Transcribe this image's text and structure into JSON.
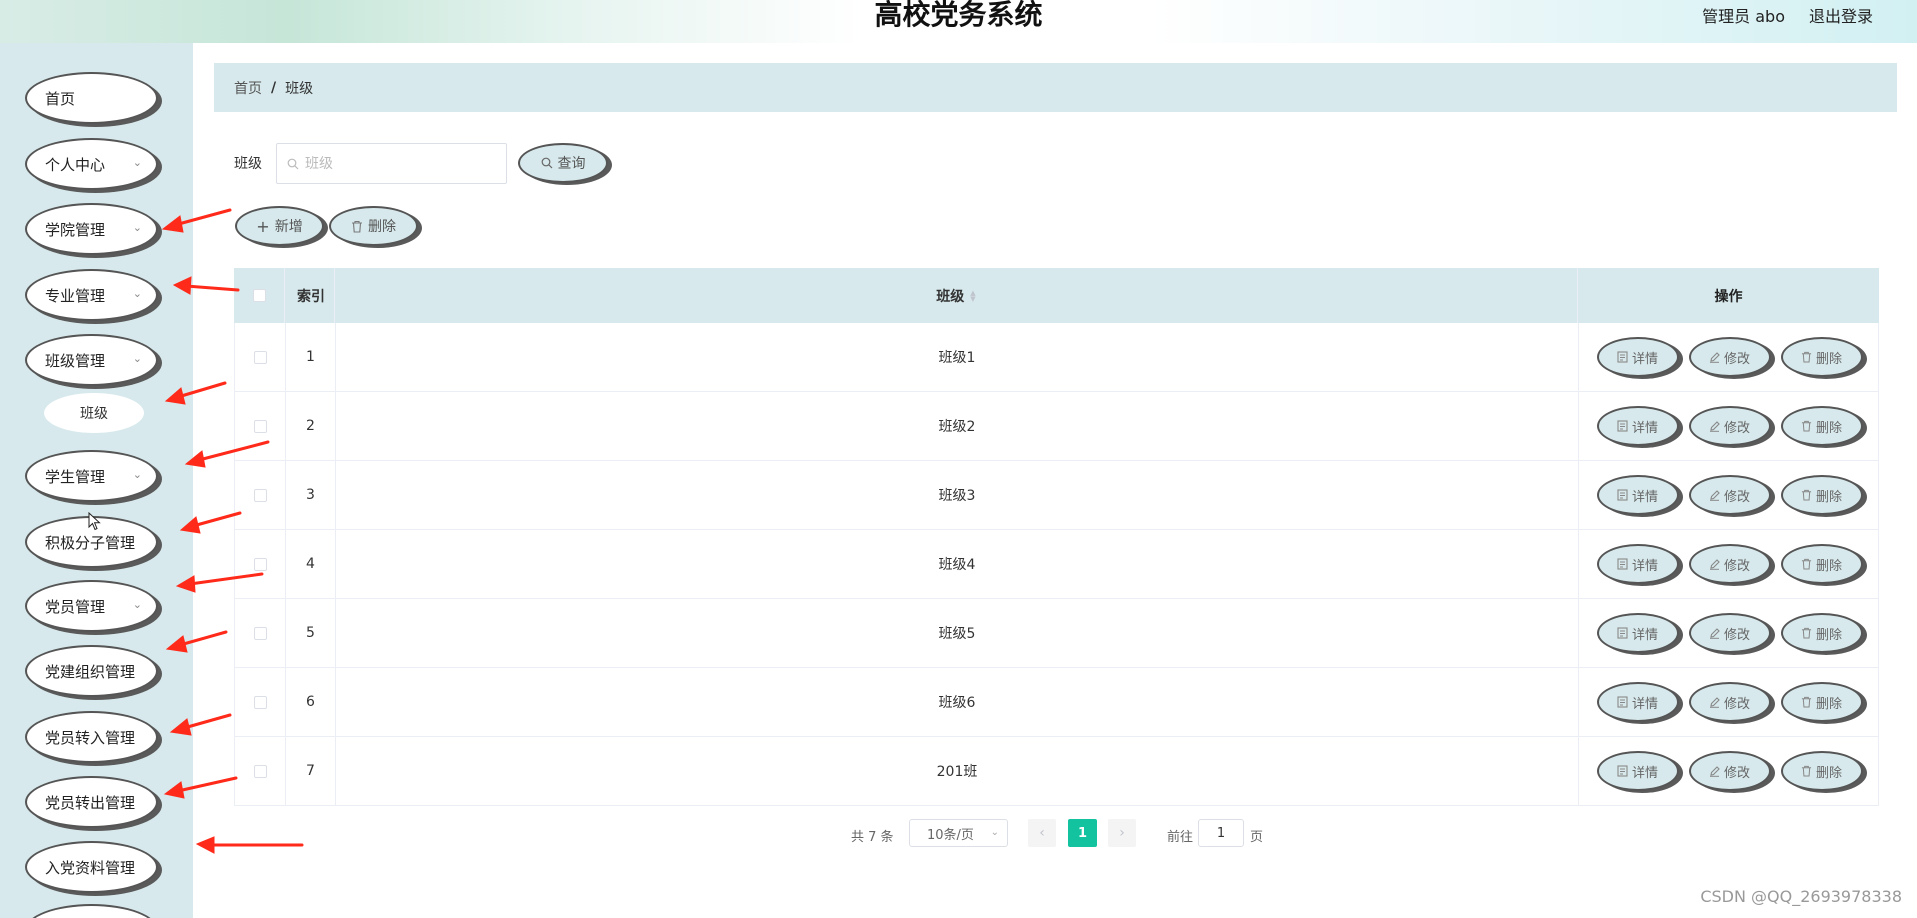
{
  "header": {
    "title": "高校党务系统",
    "admin": "管理员 abo",
    "logout": "退出登录"
  },
  "sidebar": {
    "items": [
      {
        "label": "首页",
        "chevron": false
      },
      {
        "label": "个人中心",
        "chevron": true
      },
      {
        "label": "学院管理",
        "chevron": true
      },
      {
        "label": "专业管理",
        "chevron": true
      },
      {
        "label": "班级管理",
        "chevron": true
      },
      {
        "label": "学生管理",
        "chevron": true
      },
      {
        "label": "积极分子管理",
        "chevron": false
      },
      {
        "label": "党员管理",
        "chevron": true
      },
      {
        "label": "党建组织管理",
        "chevron": false
      },
      {
        "label": "党员转入管理",
        "chevron": false
      },
      {
        "label": "党员转出管理",
        "chevron": false
      },
      {
        "label": "入党资料管理",
        "chevron": false
      }
    ],
    "submenu": {
      "label": "班级"
    }
  },
  "breadcrumb": {
    "home": "首页",
    "separator": "/",
    "current": "班级"
  },
  "search": {
    "label": "班级",
    "placeholder": "班级",
    "value": "",
    "button": "查询"
  },
  "actions": {
    "add": "新增",
    "delete": "删除"
  },
  "table": {
    "columns": {
      "index": "索引",
      "name": "班级",
      "ops": "操作"
    },
    "rows": [
      {
        "index": "1",
        "name": "班级1"
      },
      {
        "index": "2",
        "name": "班级2"
      },
      {
        "index": "3",
        "name": "班级3"
      },
      {
        "index": "4",
        "name": "班级4"
      },
      {
        "index": "5",
        "name": "班级5"
      },
      {
        "index": "6",
        "name": "班级6"
      },
      {
        "index": "7",
        "name": "201班"
      }
    ],
    "row_actions": {
      "detail": "详情",
      "edit": "修改",
      "delete": "删除"
    }
  },
  "pagination": {
    "total": "共 7 条",
    "page_size": "10条/页",
    "current_page": "1",
    "prev": "‹",
    "next": "›",
    "goto_label": "前往",
    "goto_value": "1",
    "page_suffix": "页"
  },
  "watermark": "CSDN @QQ_2693978338",
  "colors": {
    "accent": "#13c39f",
    "panel": "#d7e9ec",
    "annotation_arrow": "#ff2a1a"
  }
}
